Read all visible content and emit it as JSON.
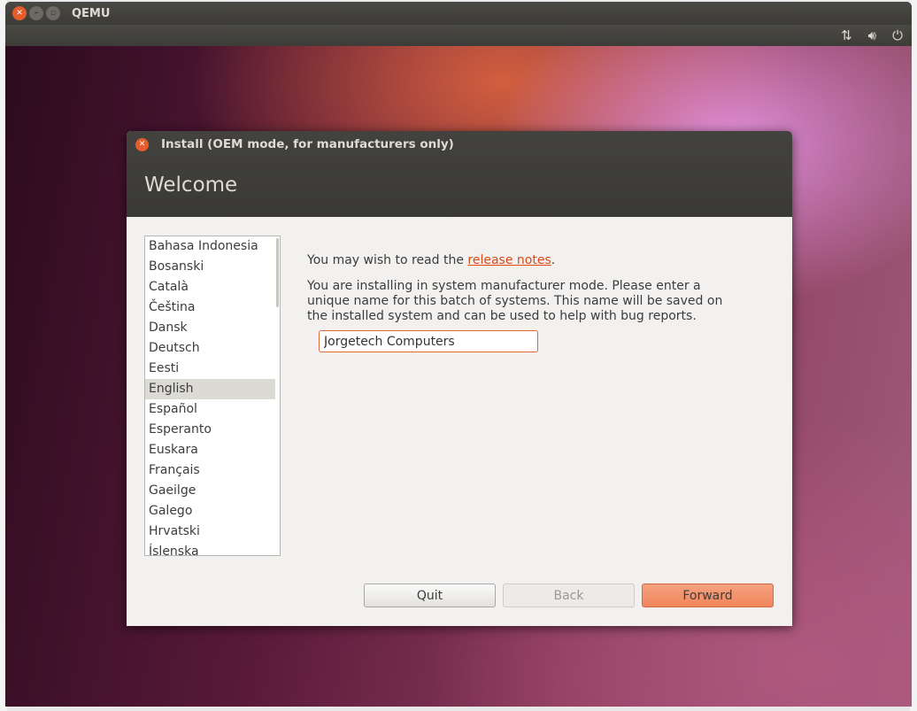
{
  "qemu": {
    "title": "QEMU"
  },
  "panel": {
    "icons": [
      "network-icon",
      "volume-icon",
      "power-icon"
    ]
  },
  "dialog": {
    "title": "Install (OEM mode, for manufacturers only)",
    "heading": "Welcome",
    "languages": [
      "Bahasa Indonesia",
      "Bosanski",
      "Català",
      "Čeština",
      "Dansk",
      "Deutsch",
      "Eesti",
      "English",
      "Español",
      "Esperanto",
      "Euskara",
      "Français",
      "Gaeilge",
      "Galego",
      "Hrvatski",
      "Íslenska"
    ],
    "selected_language": "English",
    "notes_prefix": "You may wish to read the ",
    "notes_link": "release notes",
    "notes_suffix": ".",
    "oem_text": "You are installing in system manufacturer mode. Please enter a unique name for this batch of systems. This name will be saved on the installed system and can be used to help with bug reports.",
    "oem_name": "Jorgetech Computers",
    "buttons": {
      "quit": "Quit",
      "back": "Back",
      "forward": "Forward"
    }
  },
  "colors": {
    "accent": "#dd4814",
    "forward": "#ef865b"
  }
}
